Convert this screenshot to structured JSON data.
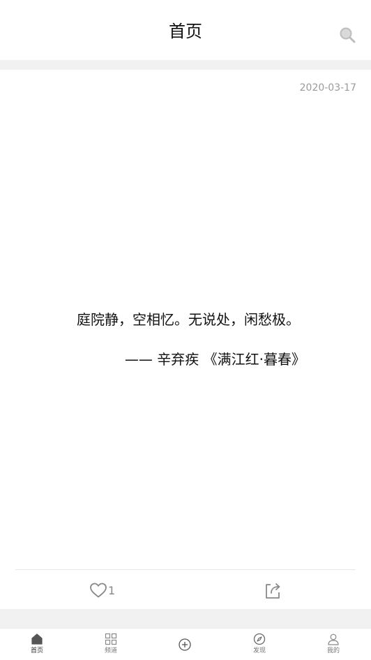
{
  "header": {
    "title": "首页",
    "search_icon": "search-icon"
  },
  "card": {
    "date": "2020-03-17",
    "quote": "庭院静，空相忆。无说处，闲愁极。",
    "source": "—— 辛弃疾 《满江红·暮春》",
    "like_count": "1",
    "like_icon": "heart-icon",
    "share_icon": "share-icon"
  },
  "tabbar": {
    "items": [
      {
        "label": "首页",
        "icon": "home-icon",
        "active": true
      },
      {
        "label": "频道",
        "icon": "grid-icon",
        "active": false
      },
      {
        "label": "",
        "icon": "add-circle-icon",
        "active": false
      },
      {
        "label": "发现",
        "icon": "compass-icon",
        "active": false
      },
      {
        "label": "我的",
        "icon": "user-icon",
        "active": false
      }
    ]
  },
  "colors": {
    "background": "#f1f1f1",
    "surface": "#ffffff",
    "text": "#111111",
    "muted": "#9a9a9a",
    "icon": "#888888"
  }
}
